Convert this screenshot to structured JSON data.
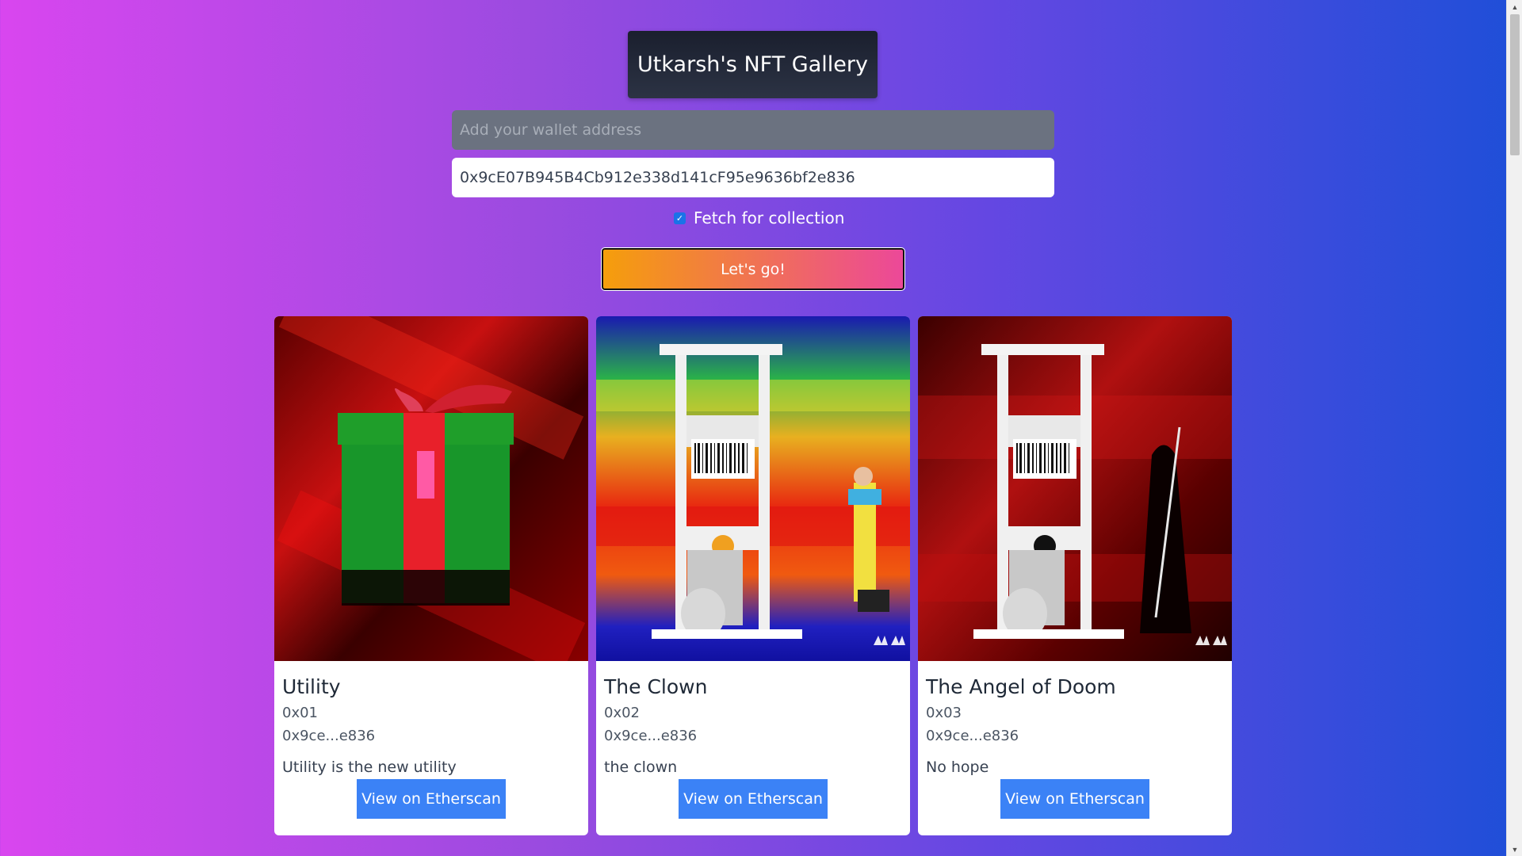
{
  "header": {
    "title": "Utkarsh's NFT Gallery"
  },
  "form": {
    "wallet_placeholder": "Add your wallet address",
    "wallet_value": "",
    "collection_value": "0x9cE07B945B4Cb912e338d141cF95e9636bf2e836",
    "fetch_checkbox_label": "Fetch for collection",
    "fetch_checked": true,
    "submit_label": "Let's go!"
  },
  "nfts": [
    {
      "title": "Utility",
      "token_id": "0x01",
      "owner": "0x9ce...e836",
      "description": "Utility is the new utility",
      "button_label": "View on Etherscan"
    },
    {
      "title": "The Clown",
      "token_id": "0x02",
      "owner": "0x9ce...e836",
      "description": "the clown",
      "button_label": "View on Etherscan"
    },
    {
      "title": "The Angel of Doom",
      "token_id": "0x03",
      "owner": "0x9ce...e836",
      "description": "No hope",
      "button_label": "View on Etherscan"
    }
  ],
  "colors": {
    "background_start": "#d946ef",
    "background_end": "#1e4fd8",
    "title_box": "#1a1f2e",
    "button_primary": "#3b82f6",
    "go_gradient_start": "#f59e0b",
    "go_gradient_end": "#ec4899"
  }
}
